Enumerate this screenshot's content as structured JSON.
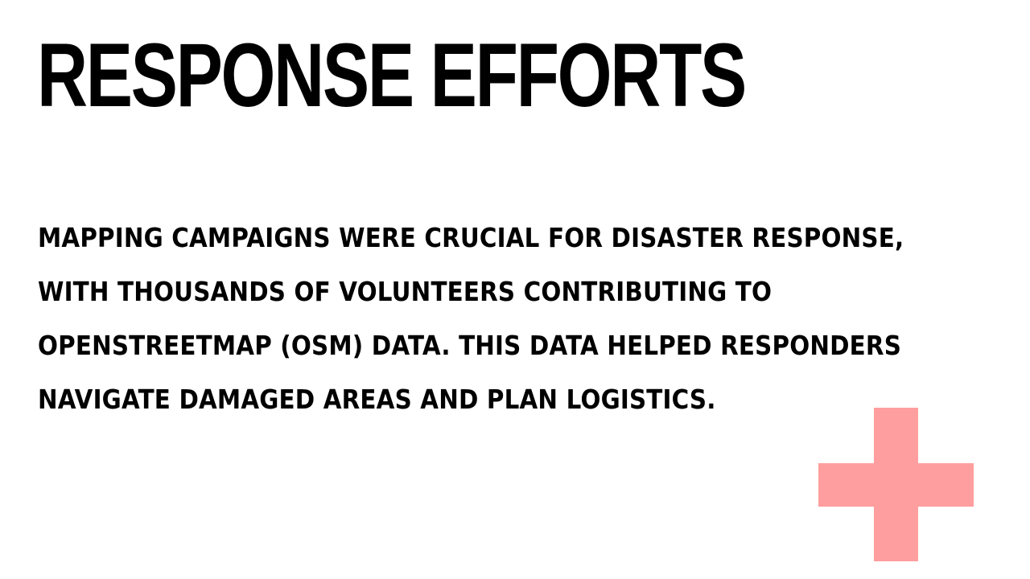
{
  "slide": {
    "title": "RESPONSE EFFORTS",
    "body_lines": [
      "MAPPING CAMPAIGNS WERE CRUCIAL FOR DISASTER RESPONSE,",
      "WITH THOUSANDS OF VOLUNTEERS CONTRIBUTING TO",
      "OPENSTREETMAP (OSM) DATA. THIS DATA HELPED RESPONDERS",
      "NAVIGATE DAMAGED AREAS AND PLAN LOGISTICS."
    ],
    "decoration_icon": "plus-cross-icon"
  },
  "colors": {
    "background": "#ffffff",
    "text": "#000000",
    "accent": "#ff9e9e"
  }
}
